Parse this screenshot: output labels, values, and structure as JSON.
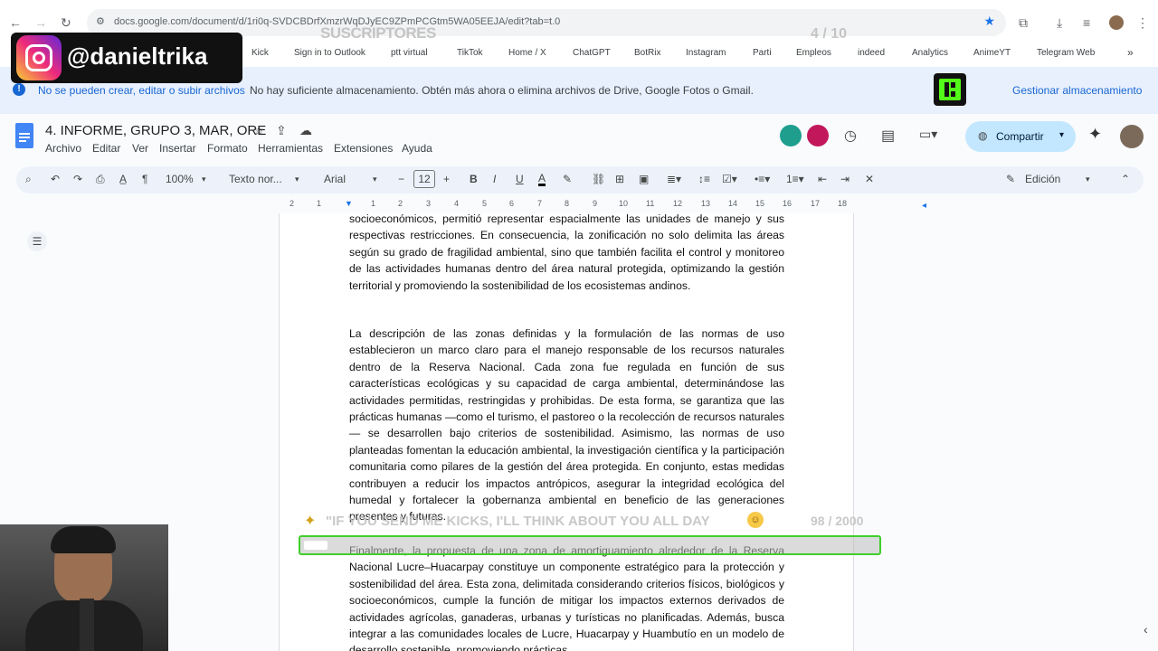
{
  "browser": {
    "url": "docs.google.com/document/d/1ri0q-SVDCBDrfXmzrWqDJyEC9ZPmPCGtm5WA05EEJA/edit?tab=t.0",
    "bookmarks": [
      "Kick",
      "Sign in to Outlook",
      "ptt virtual",
      "TikTok",
      "Home / X",
      "ChatGPT",
      "BotRix",
      "Instagram",
      "Parti",
      "Empleos",
      "indeed",
      "Analytics",
      "AnimeYT",
      "Telegram Web"
    ]
  },
  "overlay": {
    "subs_label": "SUSCRIPTORES",
    "subs_count": "4 / 10",
    "instagram_handle": "@danieltrika",
    "kicks_message": "\"IF YOU SEND ME KICKS, I'LL THINK ABOUT YOU ALL DAY",
    "kicks_count": "98 / 2000"
  },
  "notice": {
    "title": "No se pueden crear, editar o subir archivos",
    "message": "No hay suficiente almacenamiento. Obtén más ahora o elimina archivos de Drive, Google Fotos o Gmail.",
    "action": "Gestionar almacenamiento"
  },
  "doc": {
    "title": "4. INFORME, GRUPO 3, MAR, ORE",
    "menu": [
      "Archivo",
      "Editar",
      "Ver",
      "Insertar",
      "Formato",
      "Herramientas",
      "Extensiones",
      "Ayuda"
    ],
    "share_label": "Compartir",
    "mode_label": "Edición"
  },
  "toolbar": {
    "zoom": "100%",
    "style": "Texto nor...",
    "font": "Arial",
    "font_size": "12"
  },
  "ruler": {
    "ticks": [
      "2",
      "1",
      "1",
      "2",
      "3",
      "4",
      "5",
      "6",
      "7",
      "8",
      "9",
      "10",
      "11",
      "12",
      "13",
      "14",
      "15",
      "16",
      "17",
      "18"
    ]
  },
  "content": {
    "para1": "socioeconómicos, permitió representar espacialmente las unidades de manejo y sus respectivas restricciones. En consecuencia, la zonificación no solo delimita las áreas según su grado de fragilidad ambiental, sino que también facilita el control y monitoreo de las actividades humanas dentro del área natural protegida, optimizando la gestión territorial y promoviendo la sostenibilidad de los ecosistemas andinos.",
    "para2": "La descripción de las zonas definidas y la formulación de las normas de uso establecieron un marco claro para el manejo responsable de los recursos naturales dentro de la Reserva Nacional. Cada zona fue regulada en función de sus características ecológicas y su capacidad de carga ambiental, determinándose las actividades permitidas, restringidas y prohibidas. De esta forma, se garantiza que las prácticas humanas —como el turismo, el pastoreo o la recolección de recursos naturales— se desarrollen bajo criterios de sostenibilidad. Asimismo, las normas de uso planteadas fomentan la educación ambiental, la investigación científica y la participación comunitaria como pilares de la gestión del área protegida. En conjunto, estas medidas contribuyen a reducir los impactos antrópicos, asegurar la integridad ecológica del humedal y fortalecer la gobernanza ambiental en beneficio de las generaciones presentes y futuras.",
    "para3": "Finalmente, la propuesta de una zona de amortiguamiento alrededor de la Reserva Nacional Lucre–Huacarpay constituye un componente estratégico para la protección y sostenibilidad del área. Esta zona, delimitada considerando criterios físicos, biológicos y socioeconómicos, cumple la función de mitigar los impactos externos derivados de actividades agrícolas, ganaderas, urbanas y turísticas no planificadas. Además, busca integrar a las comunidades locales de Lucre, Huacarpay y Huambutío en un modelo de desarrollo sostenible, promoviendo prácticas"
  }
}
